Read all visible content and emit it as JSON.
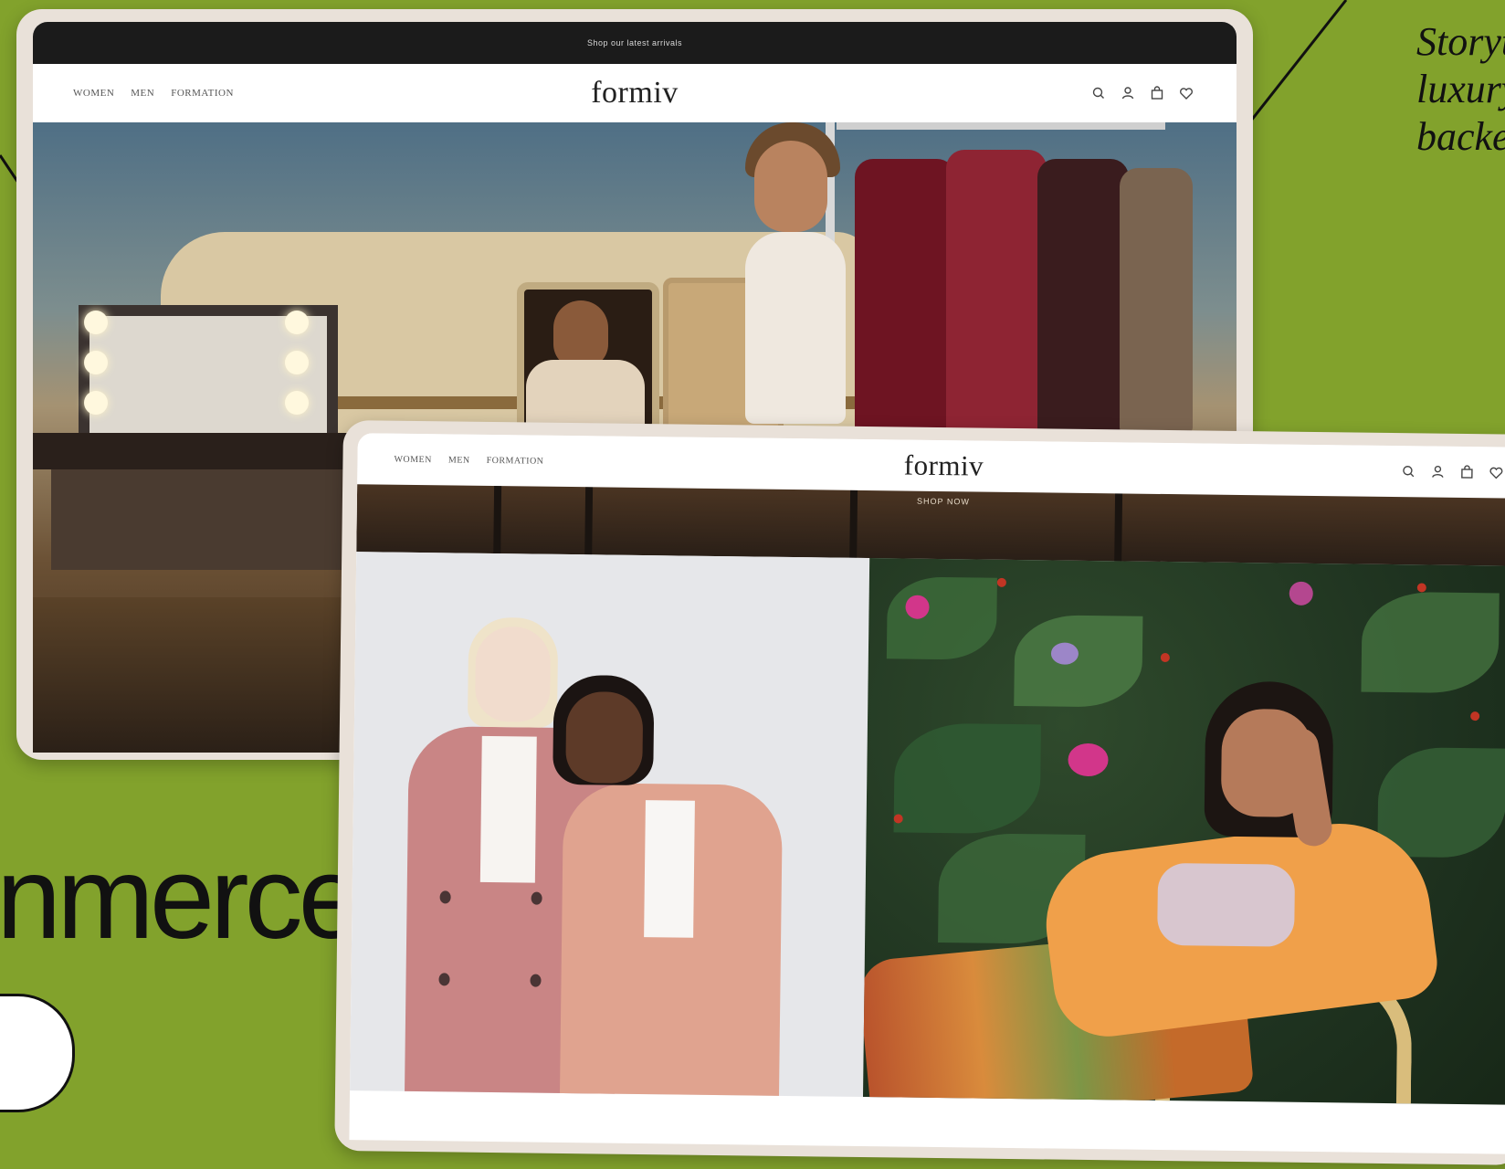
{
  "page": {
    "background_color": "#82a22c",
    "headline_fragment": "nmerce",
    "story_lines": [
      "Storyt",
      "luxury",
      "backe"
    ]
  },
  "back_site": {
    "announcement": "Shop our latest arrivals",
    "nav": [
      "WOMEN",
      "MEN",
      "FORMATION"
    ],
    "logo": "formiv",
    "icons": [
      "search-icon",
      "account-icon",
      "bag-icon",
      "heart-icon"
    ]
  },
  "front_site": {
    "nav": [
      "WOMEN",
      "MEN",
      "FORMATION"
    ],
    "logo": "formiv",
    "banner_label": "SHOP NOW",
    "icons": [
      "search-icon",
      "account-icon",
      "bag-icon",
      "heart-icon"
    ]
  },
  "colors": {
    "accent_green": "#82a22c",
    "frame": "#e9e1d9",
    "ink": "#111111"
  }
}
